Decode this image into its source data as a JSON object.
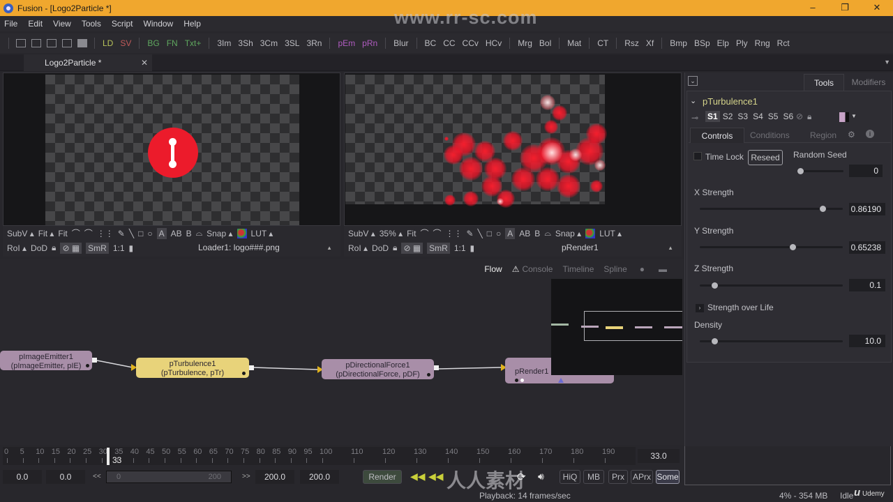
{
  "window": {
    "title": "Fusion - [Logo2Particle *]",
    "minimize": "–",
    "maximize": "❐",
    "close": "✕"
  },
  "menu": [
    "File",
    "Edit",
    "View",
    "Tools",
    "Script",
    "Window",
    "Help"
  ],
  "toolbar": {
    "groups": [
      [
        {
          "label": "LD",
          "color": "#b7c25a"
        },
        {
          "label": "SV",
          "color": "#c05a5a"
        }
      ],
      [
        {
          "label": "BG",
          "color": "#5fa85f"
        },
        {
          "label": "FN",
          "color": "#5fa85f"
        },
        {
          "label": "Txt+",
          "color": "#5fa85f"
        }
      ],
      [
        {
          "label": "3Im",
          "color": "#bdbdc2"
        },
        {
          "label": "3Sh",
          "color": "#bdbdc2"
        },
        {
          "label": "3Cm",
          "color": "#bdbdc2"
        },
        {
          "label": "3SL",
          "color": "#bdbdc2"
        },
        {
          "label": "3Rn",
          "color": "#bdbdc2"
        }
      ],
      [
        {
          "label": "pEm",
          "color": "#b05cc0"
        },
        {
          "label": "pRn",
          "color": "#b05cc0"
        }
      ],
      [
        {
          "label": "Blur",
          "color": "#bdbdc2"
        }
      ],
      [
        {
          "label": "BC",
          "color": "#bdbdc2"
        },
        {
          "label": "CC",
          "color": "#bdbdc2"
        },
        {
          "label": "CCv",
          "color": "#bdbdc2"
        },
        {
          "label": "HCv",
          "color": "#bdbdc2"
        }
      ],
      [
        {
          "label": "Mrg",
          "color": "#bdbdc2"
        },
        {
          "label": "Bol",
          "color": "#bdbdc2"
        }
      ],
      [
        {
          "label": "Mat",
          "color": "#bdbdc2"
        }
      ],
      [
        {
          "label": "CT",
          "color": "#bdbdc2"
        }
      ],
      [
        {
          "label": "Rsz",
          "color": "#bdbdc2"
        },
        {
          "label": "Xf",
          "color": "#bdbdc2"
        }
      ],
      [
        {
          "label": "Bmp",
          "color": "#bdbdc2"
        },
        {
          "label": "BSp",
          "color": "#bdbdc2"
        },
        {
          "label": "Elp",
          "color": "#bdbdc2"
        },
        {
          "label": "Ply",
          "color": "#bdbdc2"
        },
        {
          "label": "Rng",
          "color": "#bdbdc2"
        },
        {
          "label": "Rct",
          "color": "#bdbdc2"
        }
      ]
    ]
  },
  "doc_tab": {
    "label": "Logo2Particle *",
    "close": "✕"
  },
  "viewer_left": {
    "row1": [
      "SubV ▴",
      "Fit ▴",
      "Fit"
    ],
    "tools": [
      "A",
      "AB",
      "B",
      "Snap ▴",
      "LUT ▴"
    ],
    "row2": [
      "RoI ▴",
      "DoD",
      "SmR",
      "1:1"
    ],
    "title": "Loader1: logo###.png"
  },
  "viewer_right": {
    "row1": [
      "SubV ▴",
      "35% ▴",
      "Fit"
    ],
    "tools": [
      "A",
      "AB",
      "B",
      "Snap ▴",
      "LUT ▴"
    ],
    "row2": [
      "RoI ▴",
      "DoD",
      "SmR",
      "1:1"
    ],
    "title": "pRender1"
  },
  "inspector": {
    "tabs": [
      "Tools",
      "Modifiers"
    ],
    "active_tab": "Tools",
    "tool_name": "pTurbulence1",
    "versions": [
      "S1",
      "S2",
      "S3",
      "S4",
      "S5",
      "S6"
    ],
    "active_version": "S1",
    "subtabs": [
      "Controls",
      "Conditions",
      "Region"
    ],
    "active_subtab": "Controls",
    "time_lock_label": "Time Lock",
    "time_lock_checked": false,
    "reseed_label": "Reseed",
    "random_seed": {
      "label": "Random Seed",
      "value": "0",
      "fraction": 0.0
    },
    "x_strength": {
      "label": "X Strength",
      "value": "0.86190",
      "fraction": 0.86
    },
    "y_strength": {
      "label": "Y Strength",
      "value": "0.65238",
      "fraction": 0.65
    },
    "z_strength": {
      "label": "Z Strength",
      "value": "0.1",
      "fraction": 0.1
    },
    "strength_over_life": "Strength over Life",
    "density": {
      "label": "Density",
      "value": "10.0",
      "fraction": 0.1
    }
  },
  "flow": {
    "tabs": [
      "Flow",
      "Console",
      "Timeline",
      "Spline"
    ],
    "active_tab": "Flow",
    "nodes": [
      {
        "name": "pImageEmitter1",
        "type": "(pImageEmitter, pIE)",
        "color": "purple"
      },
      {
        "name": "pTurbulence1",
        "type": "(pTurbulence, pTr)",
        "color": "yellow"
      },
      {
        "name": "pDirectionalForce1",
        "type": "(pDirectionalForce, pDF)",
        "color": "purple"
      },
      {
        "name": "pRender1",
        "type": "",
        "color": "purple"
      }
    ]
  },
  "timeline": {
    "tick_labels": [
      "0",
      "5",
      "10",
      "15",
      "20",
      "25",
      "30",
      "35",
      "40",
      "45",
      "50",
      "55",
      "60",
      "65",
      "70",
      "75",
      "80",
      "85",
      "90",
      "95",
      "100",
      "110",
      "120",
      "130",
      "140",
      "150",
      "160",
      "170",
      "180",
      "190"
    ],
    "current_frame": "33",
    "current_time_field": "33.0",
    "global_start": "0.0",
    "render_start": "0.0",
    "range_start": "0",
    "range_end": "200",
    "render_end": "200.0",
    "global_end": "200.0",
    "prev_label": "<<",
    "next_label": ">>"
  },
  "playback": {
    "render_label": "Render",
    "buttons": [
      "HiQ",
      "MB",
      "Prx",
      "APrx",
      "Some"
    ],
    "active_button": "Some",
    "status": "Playback: 14 frames/sec"
  },
  "status_bar": {
    "memory": "4% - 354 MB",
    "state": "Idle"
  },
  "watermarks": {
    "site": "www.rr-sc.com",
    "brand": "Udemy"
  }
}
